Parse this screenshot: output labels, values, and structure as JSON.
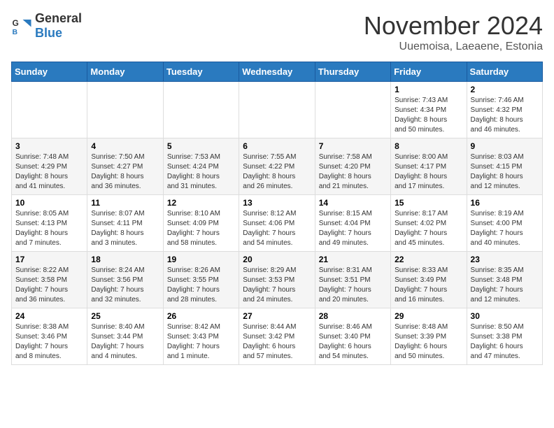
{
  "header": {
    "logo_general": "General",
    "logo_blue": "Blue",
    "month_year": "November 2024",
    "location": "Uuemoisa, Laeaene, Estonia"
  },
  "weekdays": [
    "Sunday",
    "Monday",
    "Tuesday",
    "Wednesday",
    "Thursday",
    "Friday",
    "Saturday"
  ],
  "weeks": [
    [
      {
        "day": "",
        "info": ""
      },
      {
        "day": "",
        "info": ""
      },
      {
        "day": "",
        "info": ""
      },
      {
        "day": "",
        "info": ""
      },
      {
        "day": "",
        "info": ""
      },
      {
        "day": "1",
        "info": "Sunrise: 7:43 AM\nSunset: 4:34 PM\nDaylight: 8 hours\nand 50 minutes."
      },
      {
        "day": "2",
        "info": "Sunrise: 7:46 AM\nSunset: 4:32 PM\nDaylight: 8 hours\nand 46 minutes."
      }
    ],
    [
      {
        "day": "3",
        "info": "Sunrise: 7:48 AM\nSunset: 4:29 PM\nDaylight: 8 hours\nand 41 minutes."
      },
      {
        "day": "4",
        "info": "Sunrise: 7:50 AM\nSunset: 4:27 PM\nDaylight: 8 hours\nand 36 minutes."
      },
      {
        "day": "5",
        "info": "Sunrise: 7:53 AM\nSunset: 4:24 PM\nDaylight: 8 hours\nand 31 minutes."
      },
      {
        "day": "6",
        "info": "Sunrise: 7:55 AM\nSunset: 4:22 PM\nDaylight: 8 hours\nand 26 minutes."
      },
      {
        "day": "7",
        "info": "Sunrise: 7:58 AM\nSunset: 4:20 PM\nDaylight: 8 hours\nand 21 minutes."
      },
      {
        "day": "8",
        "info": "Sunrise: 8:00 AM\nSunset: 4:17 PM\nDaylight: 8 hours\nand 17 minutes."
      },
      {
        "day": "9",
        "info": "Sunrise: 8:03 AM\nSunset: 4:15 PM\nDaylight: 8 hours\nand 12 minutes."
      }
    ],
    [
      {
        "day": "10",
        "info": "Sunrise: 8:05 AM\nSunset: 4:13 PM\nDaylight: 8 hours\nand 7 minutes."
      },
      {
        "day": "11",
        "info": "Sunrise: 8:07 AM\nSunset: 4:11 PM\nDaylight: 8 hours\nand 3 minutes."
      },
      {
        "day": "12",
        "info": "Sunrise: 8:10 AM\nSunset: 4:09 PM\nDaylight: 7 hours\nand 58 minutes."
      },
      {
        "day": "13",
        "info": "Sunrise: 8:12 AM\nSunset: 4:06 PM\nDaylight: 7 hours\nand 54 minutes."
      },
      {
        "day": "14",
        "info": "Sunrise: 8:15 AM\nSunset: 4:04 PM\nDaylight: 7 hours\nand 49 minutes."
      },
      {
        "day": "15",
        "info": "Sunrise: 8:17 AM\nSunset: 4:02 PM\nDaylight: 7 hours\nand 45 minutes."
      },
      {
        "day": "16",
        "info": "Sunrise: 8:19 AM\nSunset: 4:00 PM\nDaylight: 7 hours\nand 40 minutes."
      }
    ],
    [
      {
        "day": "17",
        "info": "Sunrise: 8:22 AM\nSunset: 3:58 PM\nDaylight: 7 hours\nand 36 minutes."
      },
      {
        "day": "18",
        "info": "Sunrise: 8:24 AM\nSunset: 3:56 PM\nDaylight: 7 hours\nand 32 minutes."
      },
      {
        "day": "19",
        "info": "Sunrise: 8:26 AM\nSunset: 3:55 PM\nDaylight: 7 hours\nand 28 minutes."
      },
      {
        "day": "20",
        "info": "Sunrise: 8:29 AM\nSunset: 3:53 PM\nDaylight: 7 hours\nand 24 minutes."
      },
      {
        "day": "21",
        "info": "Sunrise: 8:31 AM\nSunset: 3:51 PM\nDaylight: 7 hours\nand 20 minutes."
      },
      {
        "day": "22",
        "info": "Sunrise: 8:33 AM\nSunset: 3:49 PM\nDaylight: 7 hours\nand 16 minutes."
      },
      {
        "day": "23",
        "info": "Sunrise: 8:35 AM\nSunset: 3:48 PM\nDaylight: 7 hours\nand 12 minutes."
      }
    ],
    [
      {
        "day": "24",
        "info": "Sunrise: 8:38 AM\nSunset: 3:46 PM\nDaylight: 7 hours\nand 8 minutes."
      },
      {
        "day": "25",
        "info": "Sunrise: 8:40 AM\nSunset: 3:44 PM\nDaylight: 7 hours\nand 4 minutes."
      },
      {
        "day": "26",
        "info": "Sunrise: 8:42 AM\nSunset: 3:43 PM\nDaylight: 7 hours\nand 1 minute."
      },
      {
        "day": "27",
        "info": "Sunrise: 8:44 AM\nSunset: 3:42 PM\nDaylight: 6 hours\nand 57 minutes."
      },
      {
        "day": "28",
        "info": "Sunrise: 8:46 AM\nSunset: 3:40 PM\nDaylight: 6 hours\nand 54 minutes."
      },
      {
        "day": "29",
        "info": "Sunrise: 8:48 AM\nSunset: 3:39 PM\nDaylight: 6 hours\nand 50 minutes."
      },
      {
        "day": "30",
        "info": "Sunrise: 8:50 AM\nSunset: 3:38 PM\nDaylight: 6 hours\nand 47 minutes."
      }
    ]
  ]
}
